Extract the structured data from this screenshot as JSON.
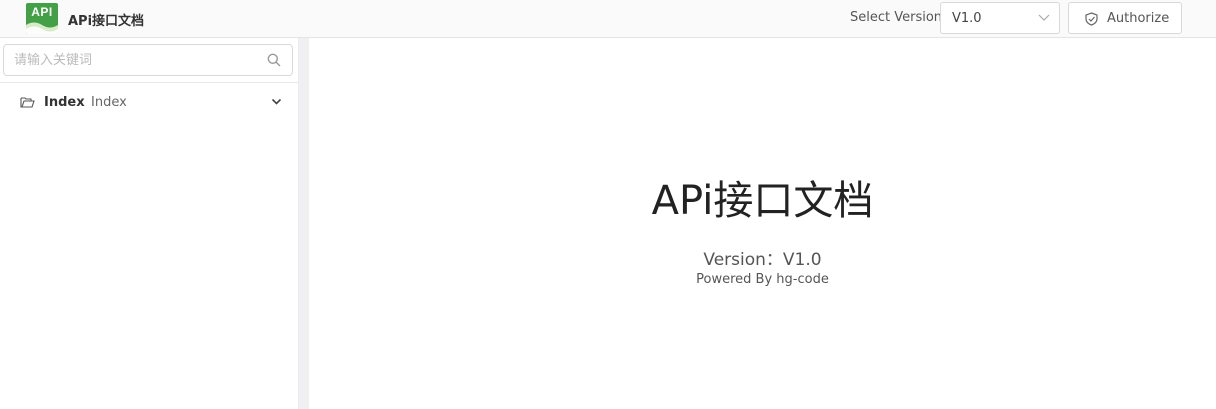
{
  "header": {
    "logo_text": "API",
    "app_title": "APi接口文档",
    "version_label": "Select Version",
    "version_selected": "V1.0",
    "authorize_label": "Authorize"
  },
  "sidebar": {
    "search_placeholder": "请输入关键词",
    "items": [
      {
        "name": "Index",
        "description": "Index",
        "icon": "folder-open-icon",
        "expanded": false
      }
    ]
  },
  "main": {
    "title": "APi接口文档",
    "version_line": "Version：V1.0",
    "powered_by": "Powered By hg-code"
  },
  "colors": {
    "logo_green": "#43a047",
    "header_bg": "#fafafa",
    "gutter": "#f0f0f2"
  }
}
